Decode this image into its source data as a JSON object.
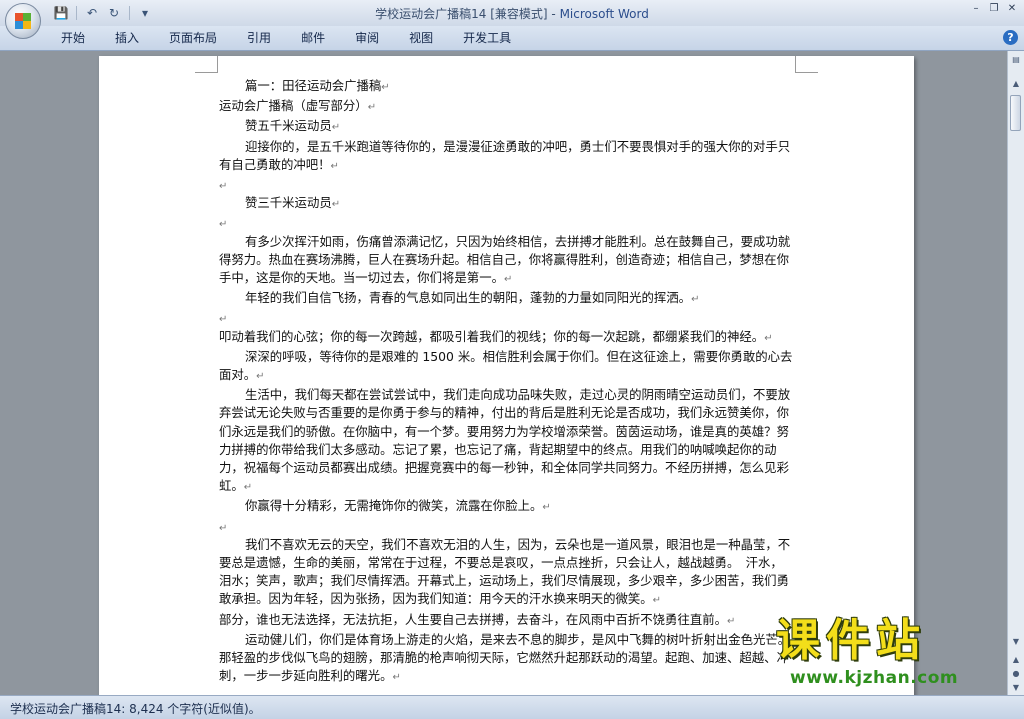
{
  "window": {
    "doc_name": "学校运动会广播稿14 [兼容模式]",
    "separator": " - ",
    "app_name": "Microsoft Word",
    "controls": {
      "minimize": "–",
      "restore": "❐",
      "close": "✕"
    }
  },
  "qat": {
    "save_icon": "💾",
    "undo_icon": "↶",
    "redo_icon": "↻",
    "more_icon": "▾"
  },
  "ribbon": {
    "tabs": [
      "开始",
      "插入",
      "页面布局",
      "引用",
      "邮件",
      "审阅",
      "视图",
      "开发工具"
    ],
    "help": "?"
  },
  "document": {
    "paragraph_mark": "↵",
    "lines": [
      {
        "text": "篇一：田径运动会广播稿",
        "indent": true
      },
      {
        "text": "运动会广播稿（虚写部分）",
        "indent": false
      },
      {
        "text": "赞五千米运动员",
        "indent": true
      },
      {
        "text": "迎接你的，是五千米跑道等待你的，是漫漫征途勇敢的冲吧，勇士们不要畏惧对手的强大你的对手只有自己勇敢的冲吧！",
        "indent": true
      },
      {
        "text": "",
        "indent": false
      },
      {
        "text": "赞三千米运动员",
        "indent": true
      },
      {
        "text": "",
        "indent": false
      },
      {
        "text": "有多少次挥汗如雨，伤痛曾添满记忆，只因为始终相信，去拼搏才能胜利。总在鼓舞自己，要成功就得努力。热血在赛场沸腾，巨人在赛场升起。相信自己，你将赢得胜利，创造奇迹；相信自己，梦想在你手中，这是你的天地。当一切过去，你们将是第一。",
        "indent": true
      },
      {
        "text": "年轻的我们自信飞扬，青春的气息如同出生的朝阳，蓬勃的力量如同阳光的挥洒。",
        "indent": true
      },
      {
        "text": "",
        "indent": false
      },
      {
        "text": "叩动着我们的心弦；你的每一次跨越，都吸引着我们的视线；你的每一次起跳，都绷紧我们的神经。",
        "indent": false
      },
      {
        "text": "深深的呼吸，等待你的是艰难的 1500 米。相信胜利会属于你们。但在这征途上，需要你勇敢的心去面对。",
        "indent": true
      },
      {
        "text": "生活中，我们每天都在尝试尝试中，我们走向成功品味失败，走过心灵的阴雨晴空运动员们，不要放弃尝试无论失败与否重要的是你勇于参与的精神，付出的背后是胜利无论是否成功，我们永远赞美你，你们永远是我们的骄傲。在你脑中，有一个梦。要用努力为学校增添荣誉。茵茵运动场，谁是真的英雄？努力拼搏的你带给我们太多感动。忘记了累，也忘记了痛，背起期望中的终点。用我们的呐喊唤起你的动力，祝福每个运动员都赛出成绩。把握竞赛中的每一秒钟，和全体同学共同努力。不经历拼搏，怎么见彩虹。",
        "indent": true
      },
      {
        "text": "你赢得十分精彩，无需掩饰你的微笑，流露在你脸上。",
        "indent": true
      },
      {
        "text": "",
        "indent": false
      },
      {
        "text": "我们不喜欢无云的天空，我们不喜欢无泪的人生，因为，云朵也是一道风景，眼泪也是一种晶莹，不要总是遗憾，生命的美丽，常常在于过程，不要总是哀叹，一点点挫折，只会让人，越战越勇。　汗水，泪水；笑声，歌声；我们尽情挥洒。开幕式上，运动场上，我们尽情展现，多少艰辛，多少困苦，我们勇敢承担。因为年轻，因为张扬，因为我们知道：用今天的汗水换来明天的微笑。",
        "indent": true
      },
      {
        "text": "部分，谁也无法选择，无法抗拒，人生要自己去拼搏，去奋斗，在风雨中百折不饶勇往直前。",
        "indent": false
      },
      {
        "text": "运动健儿们，你们是体育场上游走的火焰，是来去不息的脚步，是风中飞舞的树叶折射出金色光芒。那轻盈的步伐似飞鸟的翅膀，那清脆的枪声响彻天际，它燃然升起那跃动的渴望。起跑、加速、超越、冲刺，一步一步延向胜利的曙光。",
        "indent": true
      }
    ]
  },
  "status": {
    "text": "学校运动会广播稿14: 8,424 个字符(近似值)。"
  },
  "watermark": {
    "main": "课件站",
    "url": "www.kjzhan.com"
  }
}
